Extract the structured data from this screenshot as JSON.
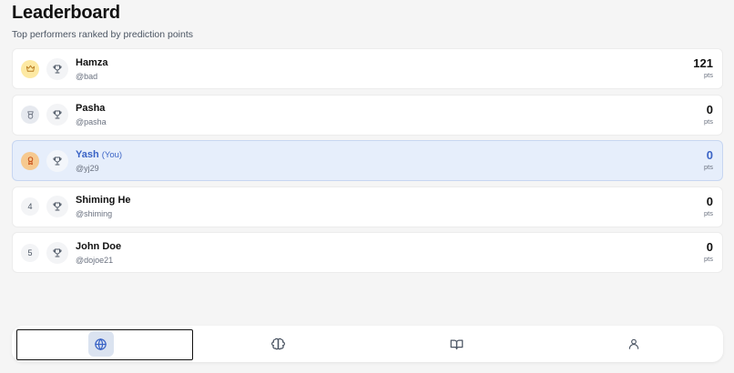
{
  "header": {
    "title": "Leaderboard",
    "subtitle": "Top performers ranked by prediction points"
  },
  "leaderboard": [
    {
      "rank": "1",
      "rank_icon": "crown-icon",
      "name": "Hamza",
      "you_label": "",
      "handle": "@bad",
      "points": "121",
      "points_unit": "pts"
    },
    {
      "rank": "2",
      "rank_icon": "medal-icon",
      "name": "Pasha",
      "you_label": "",
      "handle": "@pasha",
      "points": "0",
      "points_unit": "pts"
    },
    {
      "rank": "3",
      "rank_icon": "award-icon",
      "name": "Yash",
      "you_label": "(You)",
      "handle": "@yj29",
      "points": "0",
      "points_unit": "pts"
    },
    {
      "rank": "4",
      "rank_icon": "",
      "name": "Shiming He",
      "you_label": "",
      "handle": "@shiming",
      "points": "0",
      "points_unit": "pts"
    },
    {
      "rank": "5",
      "rank_icon": "",
      "name": "John Doe",
      "you_label": "",
      "handle": "@dojoe21",
      "points": "0",
      "points_unit": "pts"
    }
  ],
  "bottom_nav": [
    {
      "icon": "globe-icon",
      "active": true
    },
    {
      "icon": "brain-icon",
      "active": false
    },
    {
      "icon": "book-icon",
      "active": false
    },
    {
      "icon": "user-icon",
      "active": false
    }
  ],
  "colors": {
    "accent": "#3b64c6",
    "highlight_row": "#e6eefb",
    "gold": "#fde9a3",
    "silver": "#e6e9ef",
    "bronze": "#f6c98f"
  }
}
